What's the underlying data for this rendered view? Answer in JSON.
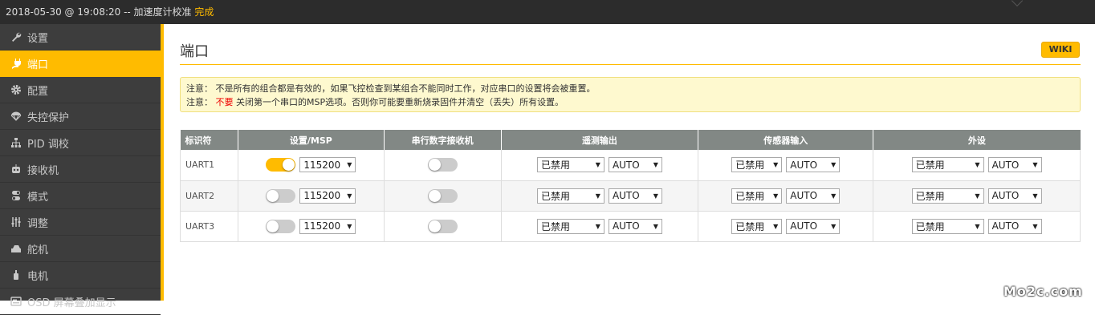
{
  "status_bar": {
    "text": "2018-05-30 @ 19:08:20 -- 加速度计校准 ",
    "done": "完成"
  },
  "sidebar": {
    "items": [
      {
        "label": "设置",
        "icon": "wrench-icon",
        "active": false
      },
      {
        "label": "端口",
        "icon": "plug-icon",
        "active": true
      },
      {
        "label": "配置",
        "icon": "gear-icon",
        "active": false
      },
      {
        "label": "失控保护",
        "icon": "parachute-icon",
        "active": false
      },
      {
        "label": "PID 调校",
        "icon": "sitemap-icon",
        "active": false
      },
      {
        "label": "接收机",
        "icon": "robot-icon",
        "active": false
      },
      {
        "label": "模式",
        "icon": "switch-icon",
        "active": false
      },
      {
        "label": "调整",
        "icon": "sliders-icon",
        "active": false
      },
      {
        "label": "舵机",
        "icon": "servo-icon",
        "active": false
      },
      {
        "label": "电机",
        "icon": "motor-icon",
        "active": false
      },
      {
        "label": "OSD 屏幕叠加显示",
        "icon": "osd-icon",
        "active": false
      }
    ]
  },
  "main": {
    "title": "端口",
    "wiki_label": "WIKI",
    "notes": {
      "line1": "注意： 不是所有的组合都是有效的，如果飞控检查到某组合不能同时工作，对应串口的设置将会被重置。",
      "line2_prefix": "注意： ",
      "line2_warn": "不要",
      "line2_rest": " 关闭第一个串口的MSP选项。否则你可能要重新烧录固件并清空（丢失）所有设置。"
    },
    "table": {
      "headers": [
        "标识符",
        "设置/MSP",
        "串行数字接收机",
        "遥测输出",
        "传感器输入",
        "外设"
      ],
      "rows": [
        {
          "id": "UART1",
          "msp_on": true,
          "baud": "115200",
          "rx_on": false,
          "telemetry": "已禁用",
          "telemetry_baud": "AUTO",
          "sensor": "已禁用",
          "sensor_baud": "AUTO",
          "peripheral": "已禁用",
          "peripheral_baud": "AUTO"
        },
        {
          "id": "UART2",
          "msp_on": false,
          "baud": "115200",
          "rx_on": false,
          "telemetry": "已禁用",
          "telemetry_baud": "AUTO",
          "sensor": "已禁用",
          "sensor_baud": "AUTO",
          "peripheral": "已禁用",
          "peripheral_baud": "AUTO"
        },
        {
          "id": "UART3",
          "msp_on": false,
          "baud": "115200",
          "rx_on": false,
          "telemetry": "已禁用",
          "telemetry_baud": "AUTO",
          "sensor": "已禁用",
          "sensor_baud": "AUTO",
          "peripheral": "已禁用",
          "peripheral_baud": "AUTO"
        }
      ]
    }
  },
  "watermark": "Mo2c.com",
  "colors": {
    "accent": "#ffbb00",
    "sidebar_bg": "#3d3d3d",
    "topbar_bg": "#2c2c2c",
    "header_bg": "#828885"
  }
}
